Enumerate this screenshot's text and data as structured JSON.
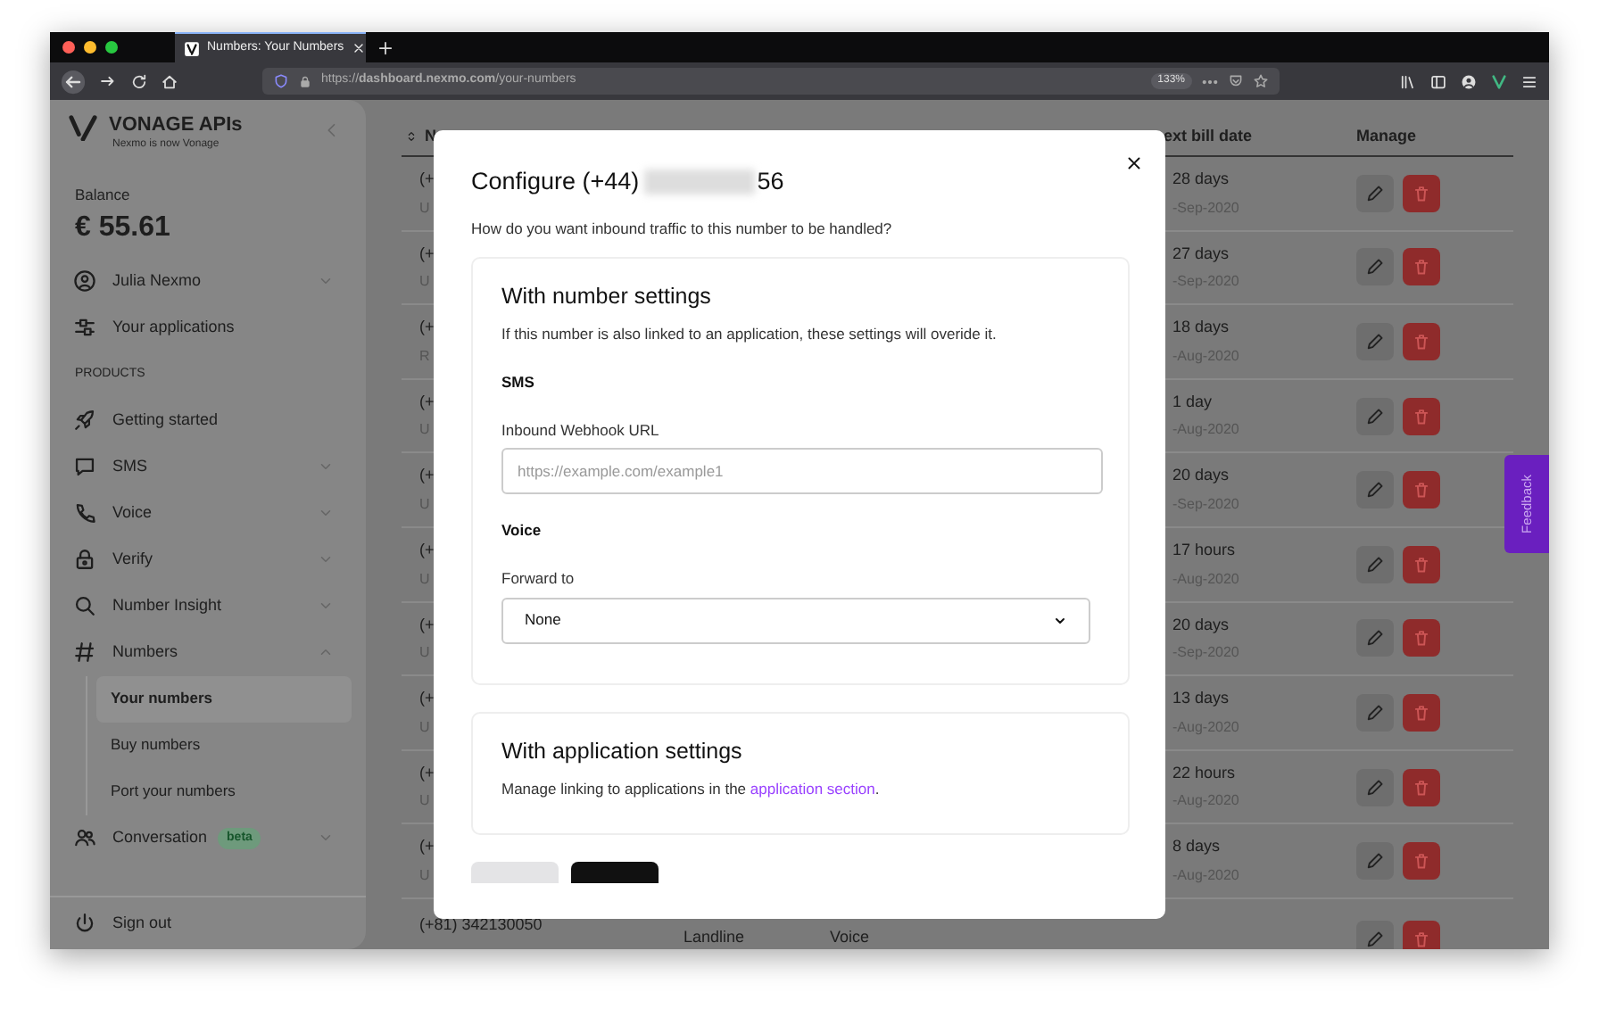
{
  "browser": {
    "tab": {
      "title": "Numbers: Your Numbers",
      "selected": true
    },
    "url": "https://**dashboard.nexmo.com**/your-numbers",
    "zoom": "133%"
  },
  "sidebar": {
    "brand": "VONAGE APIs",
    "tagline": "Nexmo is now Vonage",
    "balance_label": "Balance",
    "balance": "€ 55.61",
    "items": [
      {
        "kind": "user",
        "label": "Julia Nexmo",
        "expanded": false
      },
      {
        "kind": "link",
        "label": "Your applications"
      },
      {
        "kind": "section",
        "label": "PRODUCTS"
      },
      {
        "kind": "link",
        "label": "Getting started"
      },
      {
        "kind": "group",
        "label": "SMS",
        "expanded": false
      },
      {
        "kind": "group",
        "label": "Voice",
        "expanded": false
      },
      {
        "kind": "group",
        "label": "Verify",
        "expanded": false
      },
      {
        "kind": "group",
        "label": "Number Insight",
        "expanded": false
      },
      {
        "kind": "group",
        "label": "Numbers",
        "expanded": true,
        "children": [
          {
            "label": "Your numbers",
            "selected": true
          },
          {
            "label": "Buy numbers",
            "selected": false
          },
          {
            "label": "Port your numbers",
            "selected": false
          }
        ]
      },
      {
        "kind": "group",
        "label": "Conversation",
        "badge": "beta",
        "expanded": false
      }
    ],
    "sign_out": "Sign out"
  },
  "table": {
    "columns": [
      "N",
      "ext bill date",
      "Manage"
    ],
    "rows": [
      {
        "number": "(+",
        "detail": "U",
        "next_bill": "28 days",
        "bill_date": "-Sep-2020"
      },
      {
        "number": "(+",
        "detail": "U",
        "next_bill": "27 days",
        "bill_date": "-Sep-2020"
      },
      {
        "number": "(+",
        "detail": "R",
        "next_bill": "18 days",
        "bill_date": "-Aug-2020"
      },
      {
        "number": "(+",
        "detail": "U",
        "next_bill": "1 day",
        "bill_date": "-Aug-2020"
      },
      {
        "number": "(+",
        "detail": "U",
        "next_bill": "20 days",
        "bill_date": "-Sep-2020"
      },
      {
        "number": "(+",
        "detail": "U",
        "next_bill": "17 hours",
        "bill_date": "-Aug-2020"
      },
      {
        "number": "(+",
        "detail": "U",
        "next_bill": "20 days",
        "bill_date": "-Sep-2020"
      },
      {
        "number": "(+",
        "detail": "U",
        "next_bill": "13 days",
        "bill_date": "-Aug-2020"
      },
      {
        "number": "(+",
        "detail": "U",
        "next_bill": "22 hours",
        "bill_date": "-Aug-2020"
      },
      {
        "number": "(+",
        "detail": "U",
        "next_bill": "8 days",
        "bill_date": "-Aug-2020"
      },
      {
        "number": "(+81) 342130050",
        "type": "Landline",
        "features": "Voice"
      }
    ]
  },
  "modal": {
    "title_prefix": "Configure (+44)",
    "title_suffix": "56",
    "subtitle": "How do you want inbound traffic to this number to be handled?",
    "number_settings": {
      "heading": "With number settings",
      "description": "If this number is also linked to an application, these settings will overide it.",
      "sms_heading": "SMS",
      "webhook_label": "Inbound Webhook URL",
      "webhook_placeholder": "https://example.com/example1",
      "voice_heading": "Voice",
      "forward_label": "Forward to",
      "forward_value": "None"
    },
    "application_settings": {
      "heading": "With application settings",
      "text_before": "Manage linking to applications in the ",
      "link": "application section",
      "text_after": "."
    }
  },
  "feedback": "Feedback"
}
